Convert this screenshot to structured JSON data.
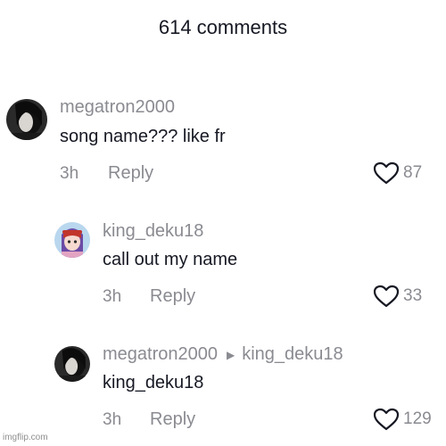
{
  "header": {
    "title": "614 comments"
  },
  "comments": [
    {
      "username": "megatron2000",
      "text": "song name??? like fr",
      "time": "3h",
      "reply_label": "Reply",
      "likes": "87",
      "avatar_icon": "dark-profile-avatar"
    },
    {
      "username": "king_deku18",
      "text": "call out my name",
      "time": "3h",
      "reply_label": "Reply",
      "likes": "33",
      "avatar_icon": "anime-girl-avatar"
    },
    {
      "username": "megatron2000",
      "reply_to": "king_deku18",
      "text": "king_deku18",
      "time": "3h",
      "reply_label": "Reply",
      "likes": "129",
      "avatar_icon": "dark-profile-avatar"
    }
  ],
  "watermark": "imgflip.com",
  "colors": {
    "text": "#161823",
    "muted": "#8a8b91",
    "background": "#ffffff"
  }
}
